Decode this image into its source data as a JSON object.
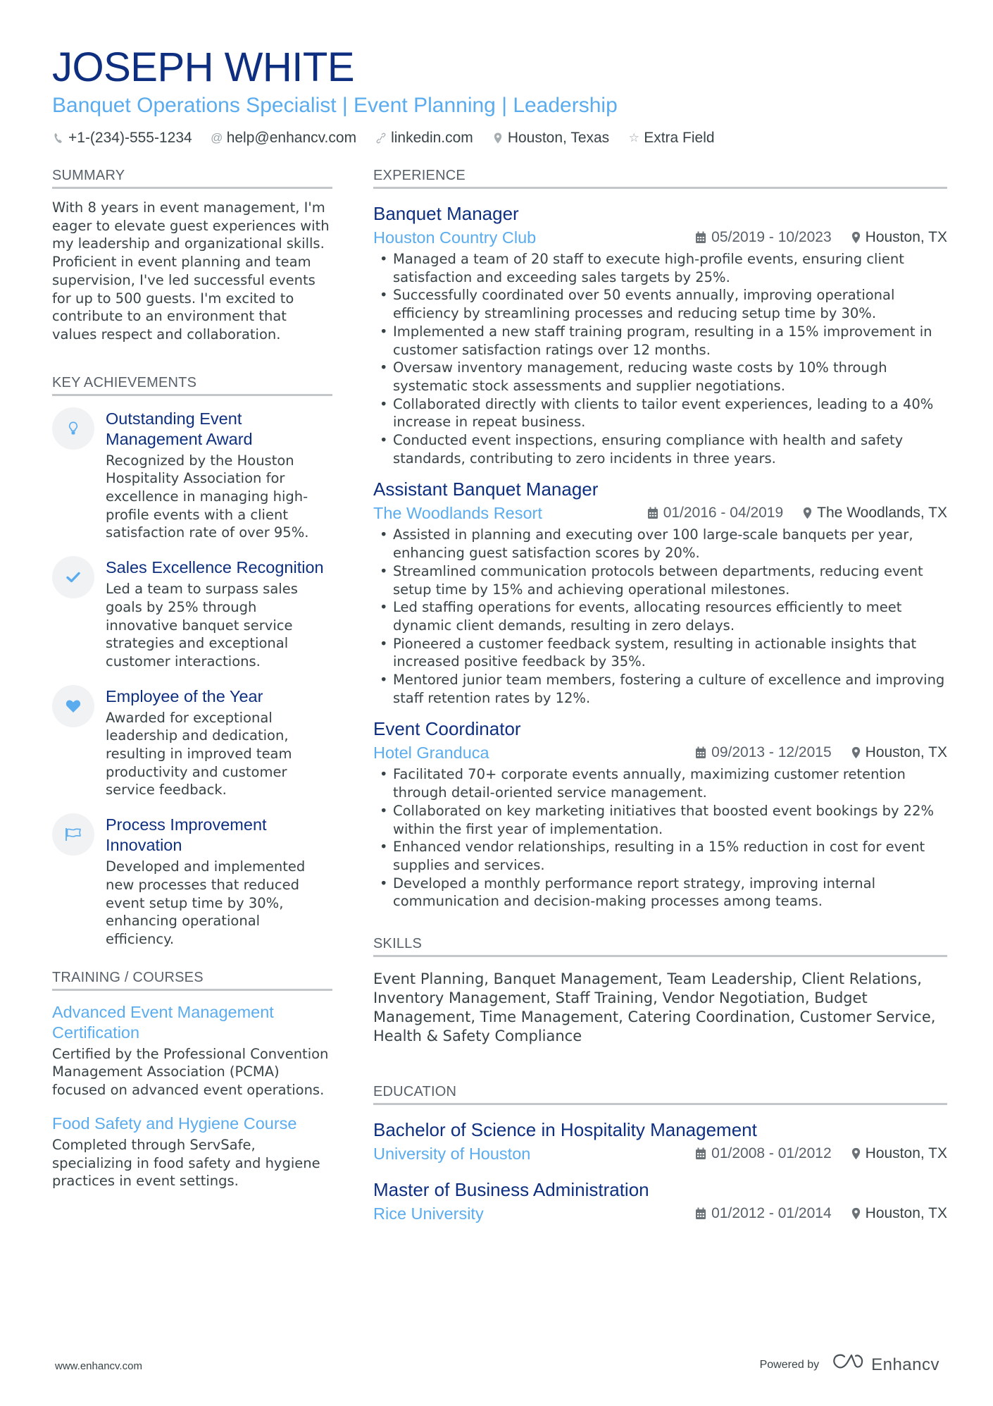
{
  "header": {
    "name": "JOSEPH WHITE",
    "title": "Banquet Operations Specialist | Event Planning | Leadership",
    "contacts": [
      {
        "icon": "phone-icon",
        "text": "+1-(234)-555-1234"
      },
      {
        "icon": "at-icon",
        "text": "help@enhancv.com"
      },
      {
        "icon": "link-icon",
        "text": "linkedin.com"
      },
      {
        "icon": "location-icon",
        "text": "Houston, Texas"
      },
      {
        "icon": "star-icon",
        "text": "Extra Field"
      }
    ]
  },
  "colors": {
    "navy": "#0e2f7f",
    "accent_blue": "#5aacee",
    "text": "#384347",
    "rule": "#c4c7ca"
  },
  "summary": {
    "heading": "SUMMARY",
    "text": "With 8 years in event management, I'm eager to elevate guest experiences with my leadership and organizational skills. Proficient in event planning and team supervision, I've led successful events for up to 500 guests. I'm excited to contribute to an environment that values respect and collaboration."
  },
  "achievements": {
    "heading": "KEY ACHIEVEMENTS",
    "items": [
      {
        "icon": "lightbulb-icon",
        "title": "Outstanding Event Management Award",
        "text": "Recognized by the Houston Hospitality Association for excellence in managing high-profile events with a client satisfaction rate of over 95%."
      },
      {
        "icon": "checkmark-icon",
        "title": "Sales Excellence Recognition",
        "text": "Led a team to surpass sales goals by 25% through innovative banquet service strategies and exceptional customer interactions."
      },
      {
        "icon": "heart-icon",
        "title": "Employee of the Year",
        "text": "Awarded for exceptional leadership and dedication, resulting in improved team productivity and customer service feedback."
      },
      {
        "icon": "flag-icon",
        "title": "Process Improvement Innovation",
        "text": "Developed and implemented new processes that reduced event setup time by 30%, enhancing operational efficiency."
      }
    ]
  },
  "training": {
    "heading": "TRAINING / COURSES",
    "items": [
      {
        "title": "Advanced Event Management Certification",
        "text": "Certified by the Professional Convention Management Association (PCMA) focused on advanced event operations."
      },
      {
        "title": "Food Safety and Hygiene Course",
        "text": "Completed through ServSafe, specializing in food safety and hygiene practices in event settings."
      }
    ]
  },
  "experience": {
    "heading": "EXPERIENCE",
    "jobs": [
      {
        "title": "Banquet Manager",
        "company": "Houston Country Club",
        "dates": "05/2019 - 10/2023",
        "location": "Houston, TX",
        "bullets": [
          "Managed a team of 20 staff to execute high-profile events, ensuring client satisfaction and exceeding sales targets by 25%.",
          "Successfully coordinated over 50 events annually, improving operational efficiency by streamlining processes and reducing setup time by 30%.",
          "Implemented a new staff training program, resulting in a 15% improvement in customer satisfaction ratings over 12 months.",
          "Oversaw inventory management, reducing waste costs by 10% through systematic stock assessments and supplier negotiations.",
          "Collaborated directly with clients to tailor event experiences, leading to a 40% increase in repeat business.",
          "Conducted event inspections, ensuring compliance with health and safety standards, contributing to zero incidents in three years."
        ]
      },
      {
        "title": "Assistant Banquet Manager",
        "company": "The Woodlands Resort",
        "dates": "01/2016 - 04/2019",
        "location": "The Woodlands, TX",
        "bullets": [
          "Assisted in planning and executing over 100 large-scale banquets per year, enhancing guest satisfaction scores by 20%.",
          "Streamlined communication protocols between departments, reducing event setup time by 15% and achieving operational milestones.",
          "Led staffing operations for events, allocating resources efficiently to meet dynamic client demands, resulting in zero delays.",
          "Pioneered a customer feedback system, resulting in actionable insights that increased positive feedback by 35%.",
          "Mentored junior team members, fostering a culture of excellence and improving staff retention rates by 12%."
        ]
      },
      {
        "title": "Event Coordinator",
        "company": "Hotel Granduca",
        "dates": "09/2013 - 12/2015",
        "location": "Houston, TX",
        "bullets": [
          "Facilitated 70+ corporate events annually, maximizing customer retention through detail-oriented service management.",
          "Collaborated on key marketing initiatives that boosted event bookings by 22% within the first year of implementation.",
          "Enhanced vendor relationships, resulting in a 15% reduction in cost for event supplies and services.",
          "Developed a monthly performance report strategy, improving internal communication and decision-making processes among teams."
        ]
      }
    ]
  },
  "skills": {
    "heading": "SKILLS",
    "text": "Event Planning, Banquet Management, Team Leadership, Client Relations, Inventory Management, Staff Training, Vendor Negotiation, Budget Management, Time Management, Catering Coordination, Customer Service, Health & Safety Compliance"
  },
  "education": {
    "heading": "EDUCATION",
    "items": [
      {
        "degree": "Bachelor of Science in Hospitality Management",
        "school": "University of Houston",
        "dates": "01/2008 - 01/2012",
        "location": "Houston, TX"
      },
      {
        "degree": "Master of Business Administration",
        "school": "Rice University",
        "dates": "01/2012 - 01/2014",
        "location": "Houston, TX"
      }
    ]
  },
  "footer": {
    "website": "www.enhancv.com",
    "powered_by": "Powered by",
    "brand": "Enhancv"
  }
}
